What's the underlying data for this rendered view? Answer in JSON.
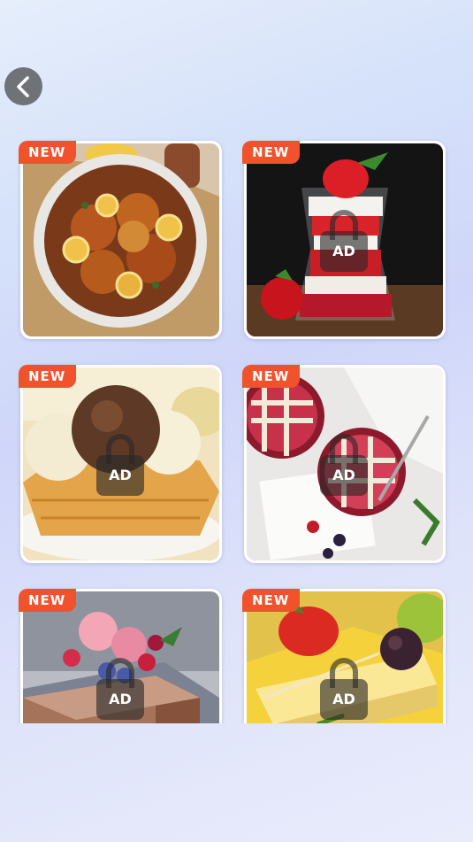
{
  "nav": {
    "back_icon": "chevron-left-icon"
  },
  "cards": [
    {
      "badge": "NEW",
      "locked": false,
      "lock_label": "",
      "subject": "chicken-lemon-bowl"
    },
    {
      "badge": "NEW",
      "locked": true,
      "lock_label": "AD",
      "subject": "strawberry-parfait"
    },
    {
      "badge": "NEW",
      "locked": true,
      "lock_label": "AD",
      "subject": "ice-cream-waffle"
    },
    {
      "badge": "NEW",
      "locked": true,
      "lock_label": "AD",
      "subject": "lattice-pies"
    },
    {
      "badge": "NEW",
      "locked": true,
      "lock_label": "AD",
      "subject": "berry-ice-cream-cake"
    },
    {
      "badge": "NEW",
      "locked": true,
      "lock_label": "AD",
      "subject": "fruit-skewers"
    }
  ],
  "colors": {
    "badge_bg": "#f0522c",
    "badge_text": "#ffffff",
    "back_button_bg": "#6f7378",
    "lock_overlay": "rgba(40,40,40,0.62)"
  }
}
